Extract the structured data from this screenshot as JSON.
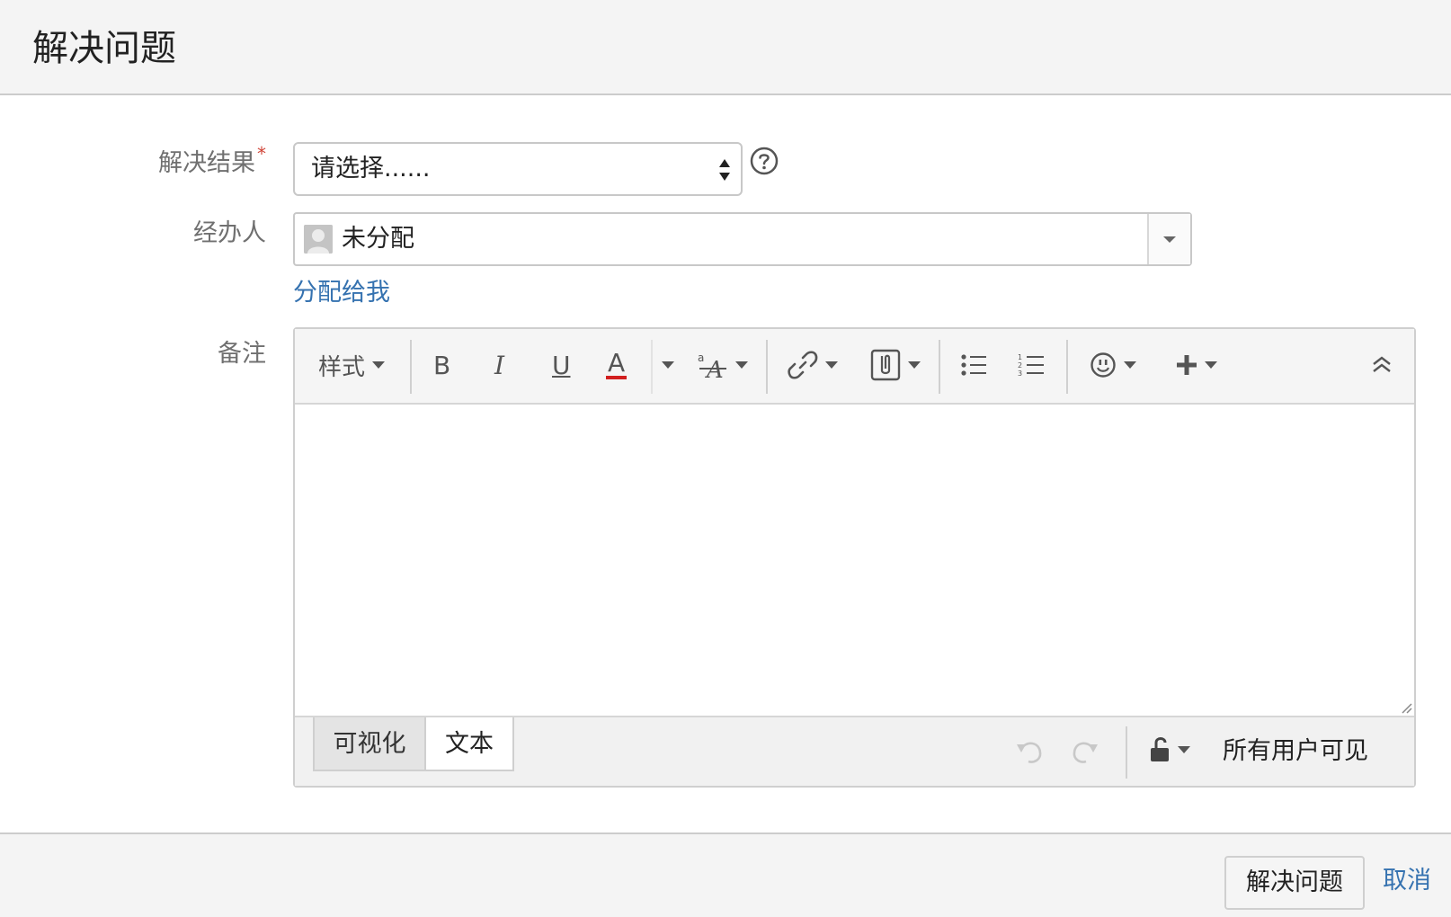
{
  "dialog": {
    "title": "解决问题"
  },
  "form": {
    "resolution": {
      "label": "解决结果",
      "required_mark": "*",
      "value": "请选择......"
    },
    "assignee": {
      "label": "经办人",
      "value": "未分配",
      "assign_to_me": "分配给我"
    },
    "comment": {
      "label": "备注"
    }
  },
  "editor": {
    "toolbar": {
      "style_label": "样式",
      "bold": "B",
      "italic": "I",
      "underline": "U",
      "text_color": "A",
      "text_color_underline": "#d21f1f"
    },
    "tabs": {
      "visual": "可视化",
      "text": "文本"
    },
    "visibility": "所有用户可见"
  },
  "footer": {
    "submit": "解决问题",
    "cancel": "取消"
  },
  "colors": {
    "link": "#3572b0",
    "required": "#d04437"
  }
}
